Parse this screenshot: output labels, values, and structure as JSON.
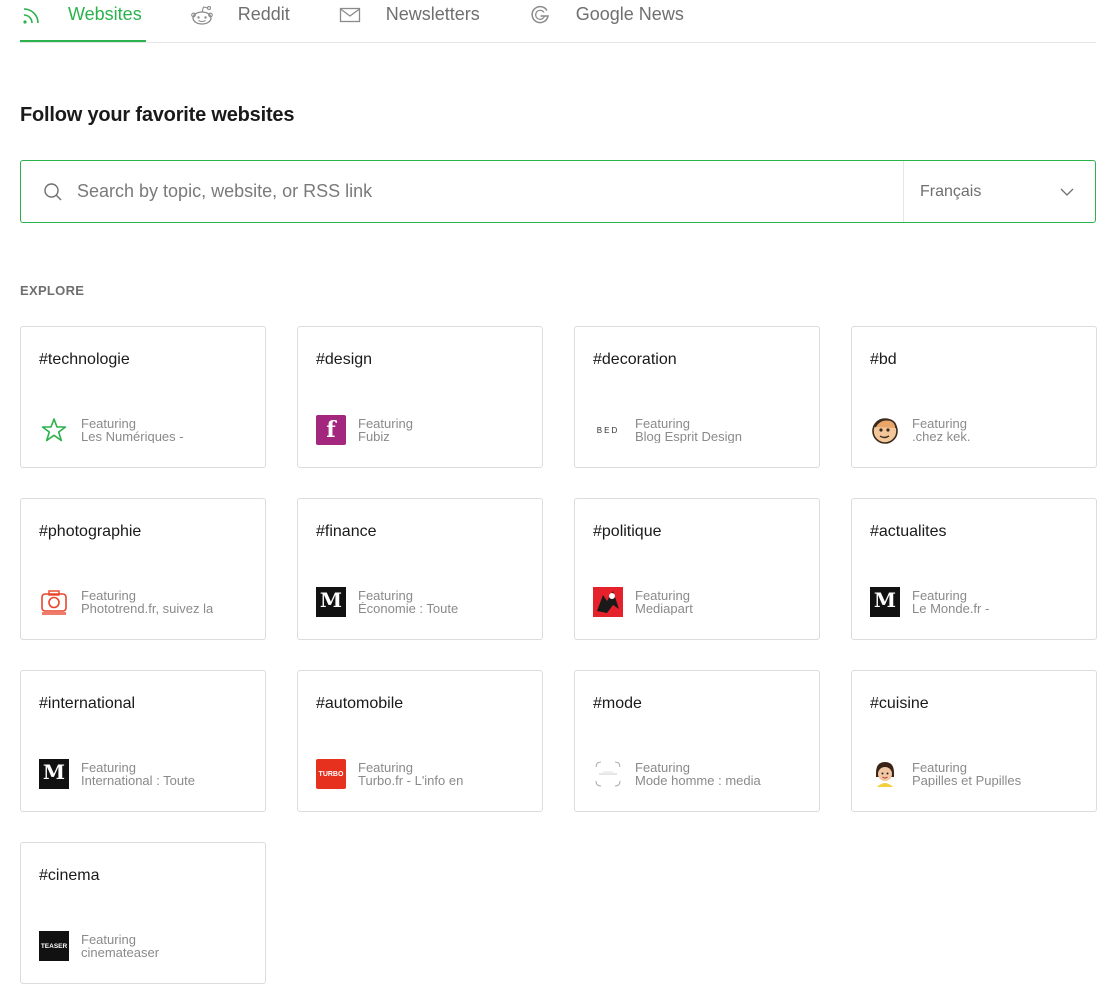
{
  "tabs": [
    {
      "label": "Websites",
      "icon": "rss-icon",
      "active": true
    },
    {
      "label": "Reddit",
      "icon": "reddit-icon",
      "active": false
    },
    {
      "label": "Newsletters",
      "icon": "mail-icon",
      "active": false
    },
    {
      "label": "Google News",
      "icon": "google-icon",
      "active": false
    }
  ],
  "heading": "Follow your favorite websites",
  "search": {
    "placeholder": "Search by topic, website, or RSS link",
    "value": ""
  },
  "language": {
    "selected": "Français"
  },
  "explore": {
    "label": "EXPLORE",
    "featuring_label": "Featuring",
    "cards": [
      {
        "tag": "#technologie",
        "source": "Les Numériques -",
        "logo": "star-logo"
      },
      {
        "tag": "#design",
        "source": "Fubiz",
        "logo": "fubiz-logo"
      },
      {
        "tag": "#decoration",
        "source": "Blog Esprit Design",
        "logo": "bed-logo",
        "logo_text": "BED"
      },
      {
        "tag": "#bd",
        "source": ".chez kek.",
        "logo": "kek-face-logo"
      },
      {
        "tag": "#photographie",
        "source": "Phototrend.fr, suivez la",
        "logo": "camera-logo"
      },
      {
        "tag": "#finance",
        "source": "Économie : Toute",
        "logo": "le-monde-logo",
        "logo_text": "M"
      },
      {
        "tag": "#politique",
        "source": "Mediapart",
        "logo": "mediapart-logo"
      },
      {
        "tag": "#actualites",
        "source": "Le Monde.fr -",
        "logo": "le-monde-logo",
        "logo_text": "M"
      },
      {
        "tag": "#international",
        "source": "International : Toute",
        "logo": "le-monde-logo",
        "logo_text": "M"
      },
      {
        "tag": "#automobile",
        "source": "Turbo.fr - L'info en",
        "logo": "turbo-logo",
        "logo_text": "TURBO"
      },
      {
        "tag": "#mode",
        "source": "Mode homme : media",
        "logo": "mode-logo"
      },
      {
        "tag": "#cuisine",
        "source": "Papilles et Pupilles",
        "logo": "cuisine-face-logo"
      },
      {
        "tag": "#cinema",
        "source": "cinemateaser",
        "logo": "teaser-logo",
        "logo_text": "TEASER"
      }
    ]
  },
  "colors": {
    "accent": "#2bb24c",
    "muted": "#6f6f6f",
    "border": "#dcdcdc"
  }
}
